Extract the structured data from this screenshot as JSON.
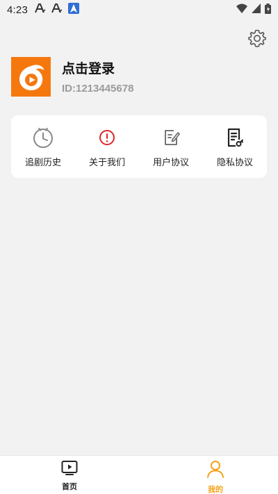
{
  "status_bar": {
    "time": "4:23",
    "icons": [
      "font-a-icon",
      "font-a-icon",
      "navigation-icon",
      "wifi-icon",
      "signal-icon",
      "battery-icon"
    ]
  },
  "header": {
    "settings_icon": "gear-icon"
  },
  "profile": {
    "login_text": "点击登录",
    "user_id": "ID:1213445678",
    "avatar_color": "#f5780f"
  },
  "menu": {
    "items": [
      {
        "label": "追剧历史",
        "icon": "history-clock-icon"
      },
      {
        "label": "关于我们",
        "icon": "info-alert-icon"
      },
      {
        "label": "用户协议",
        "icon": "document-edit-icon"
      },
      {
        "label": "隐私协议",
        "icon": "privacy-document-icon"
      }
    ]
  },
  "tab_bar": {
    "tabs": [
      {
        "label": "首页",
        "icon": "play-screen-icon",
        "active": false
      },
      {
        "label": "我的",
        "icon": "user-icon",
        "active": true
      }
    ],
    "active_color": "#f5a21b"
  }
}
